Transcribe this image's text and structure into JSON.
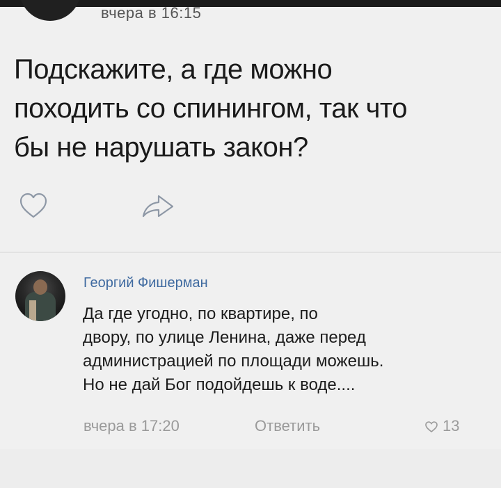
{
  "post": {
    "time": "вчера в 16:15",
    "text_lines": [
      "Подскажите, а где можно",
      "походить со спинингом, так что",
      "бы не нарушать закон?"
    ]
  },
  "actions": {
    "like_icon": "heart-outline-icon",
    "share_icon": "share-arrow-icon"
  },
  "comment": {
    "author": "Георгий Фишерман",
    "text_lines": [
      "Да где угодно, по квартире, по",
      "двору, по улице Ленина, даже перед",
      "администрацией по площади можешь.",
      "Но не дай Бог подойдешь к воде...."
    ],
    "time": "вчера в 17:20",
    "reply_label": "Ответить",
    "like_count": "13"
  },
  "colors": {
    "author_link": "#3f6aa0",
    "meta_text": "#9a9a9a",
    "body_text": "#1a1a1a"
  }
}
